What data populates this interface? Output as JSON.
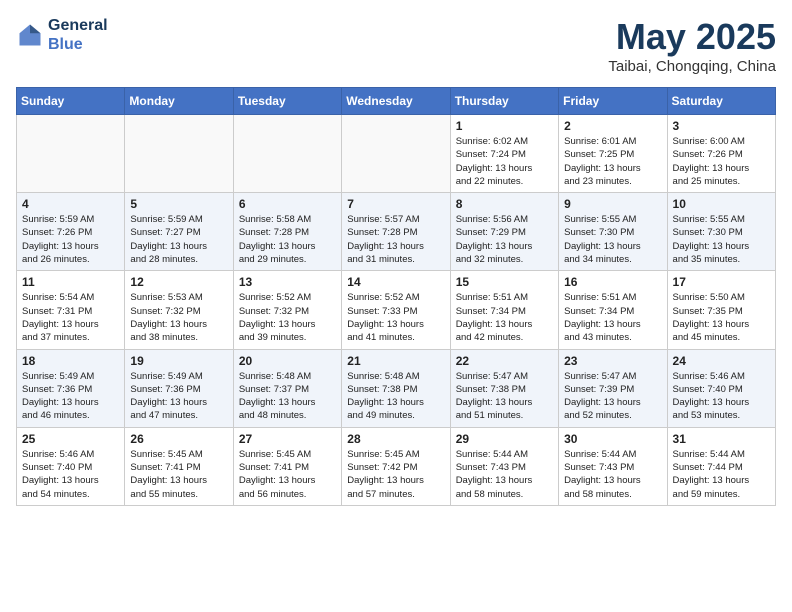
{
  "header": {
    "logo_line1": "General",
    "logo_line2": "Blue",
    "month": "May 2025",
    "location": "Taibai, Chongqing, China"
  },
  "days_of_week": [
    "Sunday",
    "Monday",
    "Tuesday",
    "Wednesday",
    "Thursday",
    "Friday",
    "Saturday"
  ],
  "weeks": [
    [
      {
        "day": "",
        "info": ""
      },
      {
        "day": "",
        "info": ""
      },
      {
        "day": "",
        "info": ""
      },
      {
        "day": "",
        "info": ""
      },
      {
        "day": "1",
        "info": "Sunrise: 6:02 AM\nSunset: 7:24 PM\nDaylight: 13 hours\nand 22 minutes."
      },
      {
        "day": "2",
        "info": "Sunrise: 6:01 AM\nSunset: 7:25 PM\nDaylight: 13 hours\nand 23 minutes."
      },
      {
        "day": "3",
        "info": "Sunrise: 6:00 AM\nSunset: 7:26 PM\nDaylight: 13 hours\nand 25 minutes."
      }
    ],
    [
      {
        "day": "4",
        "info": "Sunrise: 5:59 AM\nSunset: 7:26 PM\nDaylight: 13 hours\nand 26 minutes."
      },
      {
        "day": "5",
        "info": "Sunrise: 5:59 AM\nSunset: 7:27 PM\nDaylight: 13 hours\nand 28 minutes."
      },
      {
        "day": "6",
        "info": "Sunrise: 5:58 AM\nSunset: 7:28 PM\nDaylight: 13 hours\nand 29 minutes."
      },
      {
        "day": "7",
        "info": "Sunrise: 5:57 AM\nSunset: 7:28 PM\nDaylight: 13 hours\nand 31 minutes."
      },
      {
        "day": "8",
        "info": "Sunrise: 5:56 AM\nSunset: 7:29 PM\nDaylight: 13 hours\nand 32 minutes."
      },
      {
        "day": "9",
        "info": "Sunrise: 5:55 AM\nSunset: 7:30 PM\nDaylight: 13 hours\nand 34 minutes."
      },
      {
        "day": "10",
        "info": "Sunrise: 5:55 AM\nSunset: 7:30 PM\nDaylight: 13 hours\nand 35 minutes."
      }
    ],
    [
      {
        "day": "11",
        "info": "Sunrise: 5:54 AM\nSunset: 7:31 PM\nDaylight: 13 hours\nand 37 minutes."
      },
      {
        "day": "12",
        "info": "Sunrise: 5:53 AM\nSunset: 7:32 PM\nDaylight: 13 hours\nand 38 minutes."
      },
      {
        "day": "13",
        "info": "Sunrise: 5:52 AM\nSunset: 7:32 PM\nDaylight: 13 hours\nand 39 minutes."
      },
      {
        "day": "14",
        "info": "Sunrise: 5:52 AM\nSunset: 7:33 PM\nDaylight: 13 hours\nand 41 minutes."
      },
      {
        "day": "15",
        "info": "Sunrise: 5:51 AM\nSunset: 7:34 PM\nDaylight: 13 hours\nand 42 minutes."
      },
      {
        "day": "16",
        "info": "Sunrise: 5:51 AM\nSunset: 7:34 PM\nDaylight: 13 hours\nand 43 minutes."
      },
      {
        "day": "17",
        "info": "Sunrise: 5:50 AM\nSunset: 7:35 PM\nDaylight: 13 hours\nand 45 minutes."
      }
    ],
    [
      {
        "day": "18",
        "info": "Sunrise: 5:49 AM\nSunset: 7:36 PM\nDaylight: 13 hours\nand 46 minutes."
      },
      {
        "day": "19",
        "info": "Sunrise: 5:49 AM\nSunset: 7:36 PM\nDaylight: 13 hours\nand 47 minutes."
      },
      {
        "day": "20",
        "info": "Sunrise: 5:48 AM\nSunset: 7:37 PM\nDaylight: 13 hours\nand 48 minutes."
      },
      {
        "day": "21",
        "info": "Sunrise: 5:48 AM\nSunset: 7:38 PM\nDaylight: 13 hours\nand 49 minutes."
      },
      {
        "day": "22",
        "info": "Sunrise: 5:47 AM\nSunset: 7:38 PM\nDaylight: 13 hours\nand 51 minutes."
      },
      {
        "day": "23",
        "info": "Sunrise: 5:47 AM\nSunset: 7:39 PM\nDaylight: 13 hours\nand 52 minutes."
      },
      {
        "day": "24",
        "info": "Sunrise: 5:46 AM\nSunset: 7:40 PM\nDaylight: 13 hours\nand 53 minutes."
      }
    ],
    [
      {
        "day": "25",
        "info": "Sunrise: 5:46 AM\nSunset: 7:40 PM\nDaylight: 13 hours\nand 54 minutes."
      },
      {
        "day": "26",
        "info": "Sunrise: 5:45 AM\nSunset: 7:41 PM\nDaylight: 13 hours\nand 55 minutes."
      },
      {
        "day": "27",
        "info": "Sunrise: 5:45 AM\nSunset: 7:41 PM\nDaylight: 13 hours\nand 56 minutes."
      },
      {
        "day": "28",
        "info": "Sunrise: 5:45 AM\nSunset: 7:42 PM\nDaylight: 13 hours\nand 57 minutes."
      },
      {
        "day": "29",
        "info": "Sunrise: 5:44 AM\nSunset: 7:43 PM\nDaylight: 13 hours\nand 58 minutes."
      },
      {
        "day": "30",
        "info": "Sunrise: 5:44 AM\nSunset: 7:43 PM\nDaylight: 13 hours\nand 58 minutes."
      },
      {
        "day": "31",
        "info": "Sunrise: 5:44 AM\nSunset: 7:44 PM\nDaylight: 13 hours\nand 59 minutes."
      }
    ]
  ]
}
